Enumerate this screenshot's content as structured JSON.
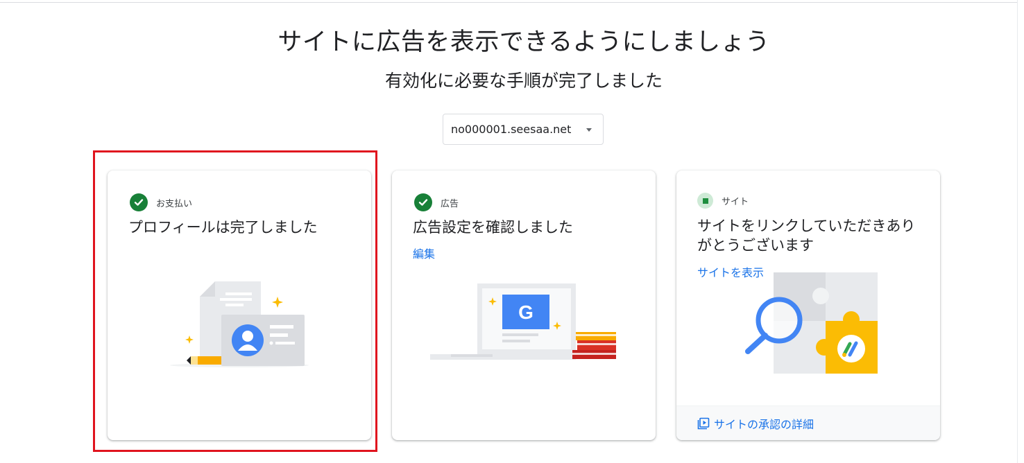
{
  "page": {
    "headline": "サイトに広告を表示できるようにしましょう",
    "subheadline": "有効化に必要な手順が完了しました"
  },
  "site_selector": {
    "selected": "no000001.seesaa.net"
  },
  "cards": [
    {
      "status_icon": "check-circle-icon",
      "status_label": "お支払い",
      "title": "プロフィールは完了しました",
      "illustration": "profile-id-card-illustration"
    },
    {
      "status_icon": "check-circle-icon",
      "status_label": "広告",
      "title": "広告設定を確認しました",
      "link": "編集",
      "illustration": "google-ads-laptop-illustration",
      "illustration_text": "G"
    },
    {
      "status_icon": "pending-square-icon",
      "status_label": "サイト",
      "title": "サイトをリンクしていただきありがとうございます",
      "link": "サイトを表示",
      "illustration": "puzzle-magnifier-illustration",
      "footer_link": "サイトの承認の詳細",
      "footer_icon": "video-library-icon"
    }
  ],
  "colors": {
    "success_green": "#188038",
    "link_blue": "#1a73e8",
    "highlight_red": "#e0141e",
    "accent_yellow": "#fbbc04",
    "accent_blue": "#4285f4"
  }
}
